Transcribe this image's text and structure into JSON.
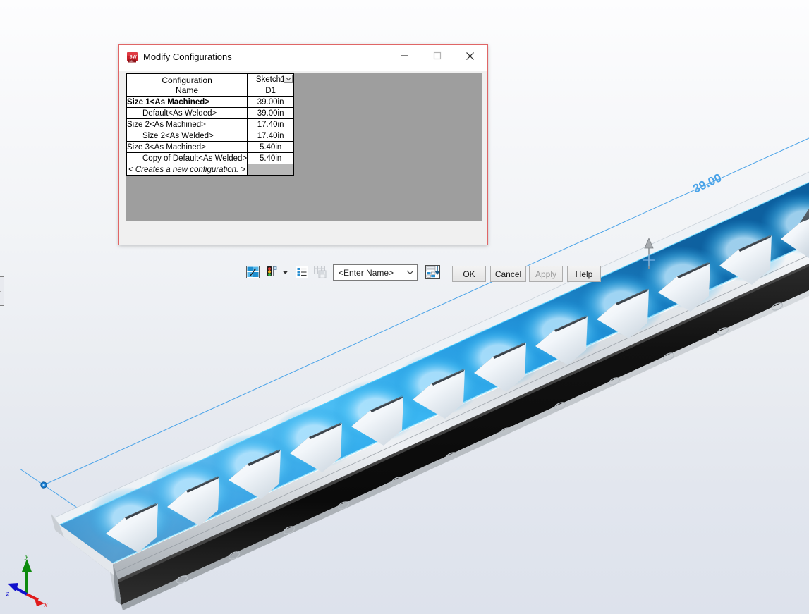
{
  "app": {
    "title": "Modify Configurations",
    "icon": "solidworks-logo-icon"
  },
  "window_controls": {
    "minimize": "minimize-icon",
    "maximize": "maximize-icon",
    "close": "close-icon"
  },
  "grid": {
    "header": {
      "name_column": "Configuration\nName",
      "name_column_line1": "Configuration",
      "name_column_line2": "Name",
      "sketch_column": "Sketch1",
      "dimension_column": "D1"
    },
    "rows": [
      {
        "name": "Size 1<As Machined>",
        "value": "39.00in",
        "indent": false,
        "active": true
      },
      {
        "name": "Default<As Welded>",
        "value": "39.00in",
        "indent": true,
        "active": false
      },
      {
        "name": "Size 2<As Machined>",
        "value": "17.40in",
        "indent": false,
        "active": false
      },
      {
        "name": "Size 2<As Welded>",
        "value": "17.40in",
        "indent": true,
        "active": false
      },
      {
        "name": "Size 3<As Machined>",
        "value": "5.40in",
        "indent": false,
        "active": false
      },
      {
        "name": "Copy of Default<As Welded>",
        "value": "5.40in",
        "indent": true,
        "active": false
      }
    ],
    "new_row_label": "< Creates a new configuration. >"
  },
  "toolbar": {
    "icons": [
      {
        "name": "configure-dimension-icon",
        "enabled": true
      },
      {
        "name": "suppression-state-icon",
        "enabled": true
      },
      {
        "name": "dropdown-arrow-icon",
        "enabled": true
      },
      {
        "name": "properties-list-icon",
        "enabled": true
      },
      {
        "name": "save-table-icon",
        "enabled": false
      },
      {
        "name": "insert-design-table-icon",
        "enabled": true
      }
    ],
    "name_combo": {
      "value": "<Enter Name>",
      "chevron": "chevron-down-icon"
    },
    "buttons": [
      {
        "label": "OK",
        "enabled": true
      },
      {
        "label": "Cancel",
        "enabled": true
      },
      {
        "label": "Apply",
        "enabled": false
      },
      {
        "label": "Help",
        "enabled": true
      }
    ]
  },
  "viewport": {
    "dimension_label": "39.00",
    "triad": {
      "x_label": "x",
      "y_label": "y",
      "z_label": "z",
      "x_color": "#e01b1b",
      "y_color": "#0d8a0d",
      "z_color": "#1111cc"
    },
    "colors": {
      "selection_blue": "#0a8fe0",
      "highlight_cyan": "#39c9ff",
      "dimension_blue": "#3399ee",
      "flange_dark": "#141414"
    },
    "model_description": "Sheet metal rail with square cutouts, selected face shown in blue"
  }
}
